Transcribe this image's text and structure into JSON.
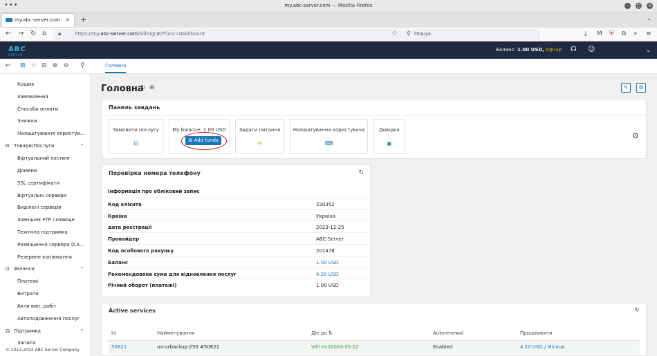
{
  "browser": {
    "window_title": "my.abc-server.com — Mozilla Firefox",
    "tab_title": "my.abc-server.com",
    "url_prefix": "https://my.",
    "url_domain": "abc-server.com",
    "url_path": "/billmgr#/?func=dashboard",
    "search_placeholder": "Пошук"
  },
  "header": {
    "logo": "ABC",
    "logo_sub": "SERVER",
    "balance_label": "Баланс:",
    "balance_value": "1.00 USD,",
    "topup": "top-up"
  },
  "nav": {
    "home_tab": "Головна"
  },
  "sidebar": {
    "items_top": [
      "Кошик",
      "Замовлення",
      "Способи оплати",
      "Знижки",
      "Налаштування користув..."
    ],
    "group_goods": "Товари/Послуги",
    "items_goods": [
      "Віртуальний хостинг",
      "Домени",
      "SSL сертифікати",
      "Віртуальні сервери",
      "Виділені сервери",
      "Зовнішнє FTP сховище",
      "Технічна підтримка",
      "Розміщення сервера (Co...",
      "Резервне копіювання"
    ],
    "group_finance": "Фінанси",
    "items_finance": [
      "Платежі",
      "Витрати",
      "Акти вип. робіт",
      "Автоподовження послуг"
    ],
    "group_support": "Підтримка",
    "items_support": [
      "Запити"
    ],
    "copyright": "© 2013-2024 ABC Server Company"
  },
  "page": {
    "title": "Головна"
  },
  "tasks": {
    "title": "Панель завдань",
    "cards": [
      "Замовити послугу",
      "My balance: 1.00 USD",
      "Задати питання",
      "Налаштування користувача",
      "Довідка"
    ],
    "add_funds": "Add funds"
  },
  "phone": {
    "title": "Перевірка номера телефону",
    "rows": [
      {
        "k": "Інформація про обліковий запис",
        "v": ""
      },
      {
        "k": "Код клієнта",
        "v": "220352"
      },
      {
        "k": "Країна",
        "v": "Україна"
      },
      {
        "k": "дата реєстрації",
        "v": "2023-12-25"
      },
      {
        "k": "Провайдер",
        "v": "ABC-Server"
      },
      {
        "k": "Код особового рахунку",
        "v": "201478"
      },
      {
        "k": "Баланс",
        "v": "1.00 USD"
      },
      {
        "k": "Рекомендована сума для відновлення послуг",
        "v": "4.20 USD"
      },
      {
        "k": "Річний оборот (платежі)",
        "v": "1.00 USD"
      }
    ]
  },
  "services": {
    "title": "Active services",
    "headers": [
      "Id",
      "Найменування",
      "Діє до ⇅",
      "Autorenewal",
      "Продовжити"
    ],
    "row": {
      "id": "50821",
      "name": "ua-urbackup-250 #50821",
      "until": "Will end2024-05-22",
      "autorenewal": "Enabled",
      "renew": "4.20 USD / Місяць"
    }
  },
  "colors": {
    "accent": "#1b75bb",
    "header_bg": "#1d2a40",
    "topup": "#f5b800",
    "green": "#3a9b3a",
    "annotation": "#d01010"
  }
}
